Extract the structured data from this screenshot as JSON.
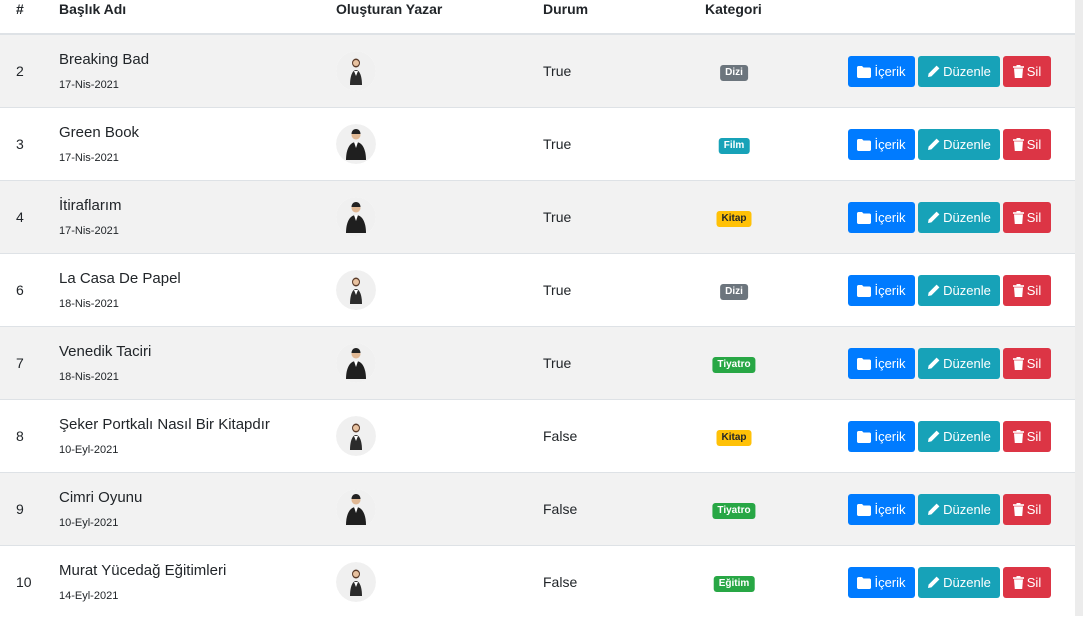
{
  "headers": {
    "num": "#",
    "title": "Başlık Adı",
    "author": "Oluşturan Yazar",
    "status": "Durum",
    "category": "Kategori"
  },
  "buttons": {
    "content": "İçerik",
    "edit": "Düzenle",
    "delete": "Sil"
  },
  "rows": [
    {
      "num": "2",
      "title": "Breaking Bad",
      "date": "17-Nis-2021",
      "author": "woman-avatar",
      "status": "True",
      "category": "Dizi"
    },
    {
      "num": "3",
      "title": "Green Book",
      "date": "17-Nis-2021",
      "author": "man-avatar",
      "status": "True",
      "category": "Film"
    },
    {
      "num": "4",
      "title": "İtiraflarım",
      "date": "17-Nis-2021",
      "author": "man-avatar",
      "status": "True",
      "category": "Kitap"
    },
    {
      "num": "6",
      "title": "La Casa De Papel",
      "date": "18-Nis-2021",
      "author": "woman-avatar",
      "status": "True",
      "category": "Dizi"
    },
    {
      "num": "7",
      "title": "Venedik Taciri",
      "date": "18-Nis-2021",
      "author": "man-avatar",
      "status": "True",
      "category": "Tiyatro"
    },
    {
      "num": "8",
      "title": "Şeker Portkalı Nasıl Bir Kitapdır",
      "date": "10-Eyl-2021",
      "author": "woman-avatar",
      "status": "False",
      "category": "Kitap"
    },
    {
      "num": "9",
      "title": "Cimri Oyunu",
      "date": "10-Eyl-2021",
      "author": "man-avatar",
      "status": "False",
      "category": "Tiyatro"
    },
    {
      "num": "10",
      "title": "Murat Yücedağ Eğitimleri",
      "date": "14-Eyl-2021",
      "author": "woman-avatar",
      "status": "False",
      "category": "Eğitim"
    }
  ],
  "colors": {
    "content_button": "#007bff",
    "edit_button": "#17a2b8",
    "delete_button": "#dc3545",
    "badge_dizi": "#6c757d",
    "badge_film": "#17a2b8",
    "badge_kitap": "#ffc107",
    "badge_tiyatro": "#28a745",
    "badge_egitim": "#28a745"
  }
}
